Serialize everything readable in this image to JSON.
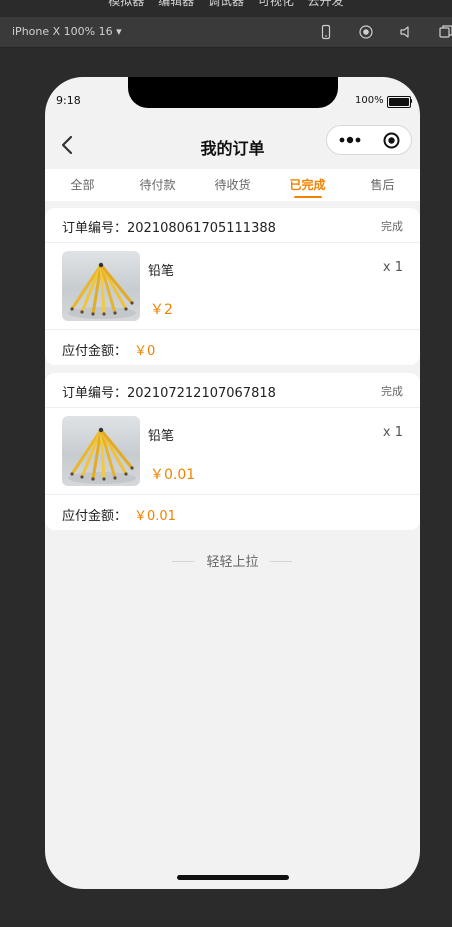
{
  "ide": {
    "menu": [
      "模拟器",
      "编辑器",
      "调试器",
      "可视化",
      "云开发"
    ],
    "device_label": "iPhone X 100% 16 ▾"
  },
  "status_bar": {
    "time": "9:18",
    "battery": "100%"
  },
  "nav": {
    "title": "我的订单"
  },
  "tabs": [
    {
      "label": "全部",
      "active": false
    },
    {
      "label": "待付款",
      "active": false
    },
    {
      "label": "待收货",
      "active": false
    },
    {
      "label": "已完成",
      "active": true
    },
    {
      "label": "售后",
      "active": false
    }
  ],
  "orders": [
    {
      "order_no": "订单编号：202108061705111388",
      "status": "完成",
      "item_name": "铅笔",
      "qty": "x 1",
      "price": "￥2",
      "pay_label": "应付金额：",
      "pay_amount": "￥0"
    },
    {
      "order_no": "订单编号：202107212107067818",
      "status": "完成",
      "item_name": "铅笔",
      "qty": "x 1",
      "price": "￥0.01",
      "pay_label": "应付金额：",
      "pay_amount": "￥0.01"
    }
  ],
  "pull_hint": "轻轻上拉",
  "colors": {
    "accent": "#f08300",
    "background": "#f2f2f2"
  },
  "icons": {
    "back": "chevron-left-icon",
    "capsule_more": "more-dots-icon",
    "capsule_close": "target-icon",
    "product": "pencils-image"
  }
}
